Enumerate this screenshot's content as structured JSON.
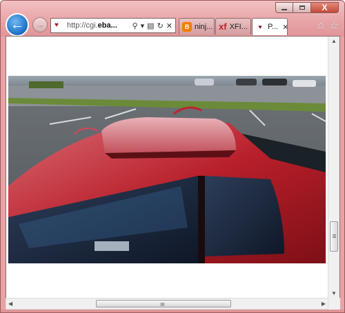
{
  "browser": {
    "address": {
      "url_prefix": "http://cgi.",
      "url_domain": "eba..."
    },
    "tabs": [
      {
        "label": "ninj...",
        "icon": "blogger-icon",
        "active": false
      },
      {
        "label": "XFI...",
        "icon": "xf-icon",
        "active": false
      },
      {
        "label": "P...",
        "icon": "site-icon",
        "active": true
      }
    ],
    "caption": {
      "close_glyph": "X"
    },
    "icons": {
      "back": "back-arrow-icon",
      "forward": "forward-arrow-icon",
      "search": "search-icon",
      "compat": "compatibility-view-icon",
      "refresh": "refresh-icon",
      "stop": "stop-icon",
      "home": "home-icon",
      "favorites": "favorites-star-icon"
    },
    "colors": {
      "frame": "#e8a2a4",
      "back_button": "#1a6fc4",
      "car_paint": "#b81f2a"
    }
  },
  "page": {
    "photo_alt": ""
  }
}
